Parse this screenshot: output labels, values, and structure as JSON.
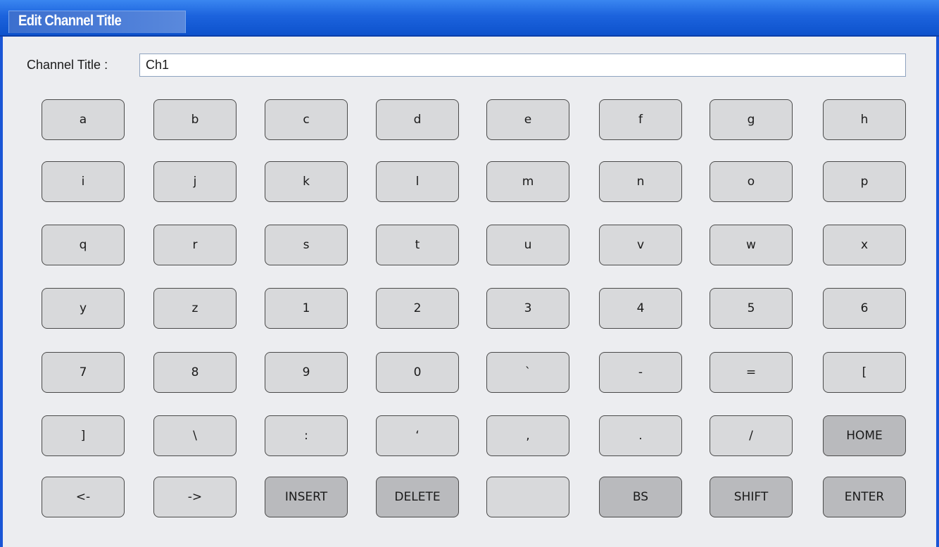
{
  "window": {
    "title": "Edit Channel Title",
    "accent_color": "#1a56d6"
  },
  "field": {
    "label": "Channel Title :",
    "value": "Ch1"
  },
  "keyboard": {
    "rows": [
      [
        {
          "label": "a"
        },
        {
          "label": "b"
        },
        {
          "label": "c"
        },
        {
          "label": "d"
        },
        {
          "label": "e"
        },
        {
          "label": "f"
        },
        {
          "label": "g"
        },
        {
          "label": "h"
        }
      ],
      [
        {
          "label": "i"
        },
        {
          "label": "j"
        },
        {
          "label": "k"
        },
        {
          "label": "l"
        },
        {
          "label": "m"
        },
        {
          "label": "n"
        },
        {
          "label": "o"
        },
        {
          "label": "p"
        }
      ],
      [
        {
          "label": "q"
        },
        {
          "label": "r"
        },
        {
          "label": "s"
        },
        {
          "label": "t"
        },
        {
          "label": "u"
        },
        {
          "label": "v"
        },
        {
          "label": "w"
        },
        {
          "label": "x"
        }
      ],
      [
        {
          "label": "y"
        },
        {
          "label": "z"
        },
        {
          "label": "1"
        },
        {
          "label": "2"
        },
        {
          "label": "3"
        },
        {
          "label": "4"
        },
        {
          "label": "5"
        },
        {
          "label": "6"
        }
      ],
      [
        {
          "label": "7"
        },
        {
          "label": "8"
        },
        {
          "label": "9"
        },
        {
          "label": "0"
        },
        {
          "label": "`"
        },
        {
          "label": "-"
        },
        {
          "label": "="
        },
        {
          "label": "["
        }
      ],
      [
        {
          "label": "]"
        },
        {
          "label": "\\"
        },
        {
          "label": ":"
        },
        {
          "label": "‘"
        },
        {
          "label": ","
        },
        {
          "label": "."
        },
        {
          "label": "/"
        },
        {
          "label": "HOME",
          "special": true
        }
      ],
      [
        {
          "label": "<-"
        },
        {
          "label": "->"
        },
        {
          "label": "INSERT",
          "special": true
        },
        {
          "label": "DELETE",
          "special": true
        },
        {
          "label": ""
        },
        {
          "label": "BS",
          "special": true
        },
        {
          "label": "SHIFT",
          "special": true
        },
        {
          "label": "ENTER",
          "special": true
        }
      ]
    ]
  }
}
